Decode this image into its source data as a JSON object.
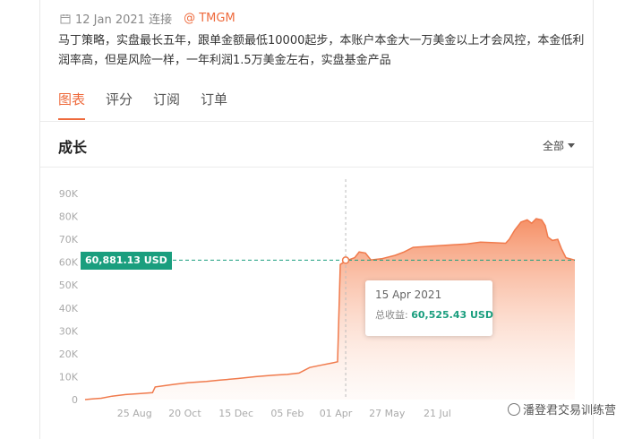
{
  "post": {
    "date": "12 Jan 2021 连接",
    "author": "@ TMGM",
    "description": "马丁策略，实盘最长五年，跟单金额最低10000起步，本账户本金大一万美金以上才会风控，本金低利润率高，但是风险一样，一年利润1.5万美金左右，实盘基金产品"
  },
  "tabs": [
    {
      "label": "图表",
      "active": true
    },
    {
      "label": "评分",
      "active": false
    },
    {
      "label": "订阅",
      "active": false
    },
    {
      "label": "订单",
      "active": false
    }
  ],
  "section": {
    "title": "成长",
    "range_label": "全部"
  },
  "tooltip": {
    "date": "15 Apr 2021",
    "label": "总收益:",
    "value": "60,525.43 USD"
  },
  "crosshair_badge": "60,881.13 USD",
  "watermark": "潘登君交易训练营",
  "colors": {
    "accent": "#ee6a3c",
    "line": "#f07a4c",
    "badge": "#1a9e7e"
  },
  "chart_data": {
    "type": "area",
    "yticks": [
      "0",
      "10K",
      "20K",
      "30K",
      "40K",
      "50K",
      "60K",
      "70K",
      "80K",
      "90K"
    ],
    "ylim": [
      0,
      90000
    ],
    "xticks": [
      "25 Aug",
      "20 Oct",
      "15 Dec",
      "05 Feb",
      "01 Apr",
      "27 May",
      "21 Jul"
    ],
    "points": [
      {
        "t": 0,
        "v": 0
      },
      {
        "t": 8,
        "v": 300
      },
      {
        "t": 18,
        "v": 600
      },
      {
        "t": 30,
        "v": 1500
      },
      {
        "t": 45,
        "v": 2200
      },
      {
        "t": 60,
        "v": 2600
      },
      {
        "t": 75,
        "v": 3000
      },
      {
        "t": 78,
        "v": 5500
      },
      {
        "t": 90,
        "v": 6200
      },
      {
        "t": 100,
        "v": 6700
      },
      {
        "t": 115,
        "v": 7400
      },
      {
        "t": 135,
        "v": 7900
      },
      {
        "t": 150,
        "v": 8500
      },
      {
        "t": 170,
        "v": 9200
      },
      {
        "t": 190,
        "v": 10000
      },
      {
        "t": 210,
        "v": 10700
      },
      {
        "t": 225,
        "v": 11000
      },
      {
        "t": 238,
        "v": 11600
      },
      {
        "t": 250,
        "v": 14000
      },
      {
        "t": 262,
        "v": 15000
      },
      {
        "t": 275,
        "v": 16000
      },
      {
        "t": 281,
        "v": 16500
      },
      {
        "t": 284,
        "v": 59000
      },
      {
        "t": 290,
        "v": 60525
      },
      {
        "t": 300,
        "v": 62000
      },
      {
        "t": 305,
        "v": 64500
      },
      {
        "t": 312,
        "v": 64000
      },
      {
        "t": 318,
        "v": 61000
      },
      {
        "t": 330,
        "v": 61500
      },
      {
        "t": 345,
        "v": 63000
      },
      {
        "t": 355,
        "v": 64500
      },
      {
        "t": 365,
        "v": 66500
      },
      {
        "t": 385,
        "v": 67000
      },
      {
        "t": 405,
        "v": 67500
      },
      {
        "t": 425,
        "v": 68000
      },
      {
        "t": 440,
        "v": 68800
      },
      {
        "t": 455,
        "v": 68500
      },
      {
        "t": 468,
        "v": 68300
      },
      {
        "t": 472,
        "v": 70000
      },
      {
        "t": 478,
        "v": 74000
      },
      {
        "t": 485,
        "v": 77500
      },
      {
        "t": 492,
        "v": 78500
      },
      {
        "t": 497,
        "v": 77000
      },
      {
        "t": 502,
        "v": 79000
      },
      {
        "t": 508,
        "v": 78500
      },
      {
        "t": 512,
        "v": 76000
      },
      {
        "t": 515,
        "v": 71000
      },
      {
        "t": 520,
        "v": 69500
      },
      {
        "t": 526,
        "v": 70000
      },
      {
        "t": 530,
        "v": 66000
      },
      {
        "t": 535,
        "v": 62000
      },
      {
        "t": 545,
        "v": 60881
      }
    ],
    "t_range": [
      0,
      545
    ],
    "xtick_t": [
      55,
      111,
      168,
      225,
      279,
      336,
      392
    ],
    "crosshair": {
      "t": 290,
      "v": 60881
    },
    "grid": false
  }
}
